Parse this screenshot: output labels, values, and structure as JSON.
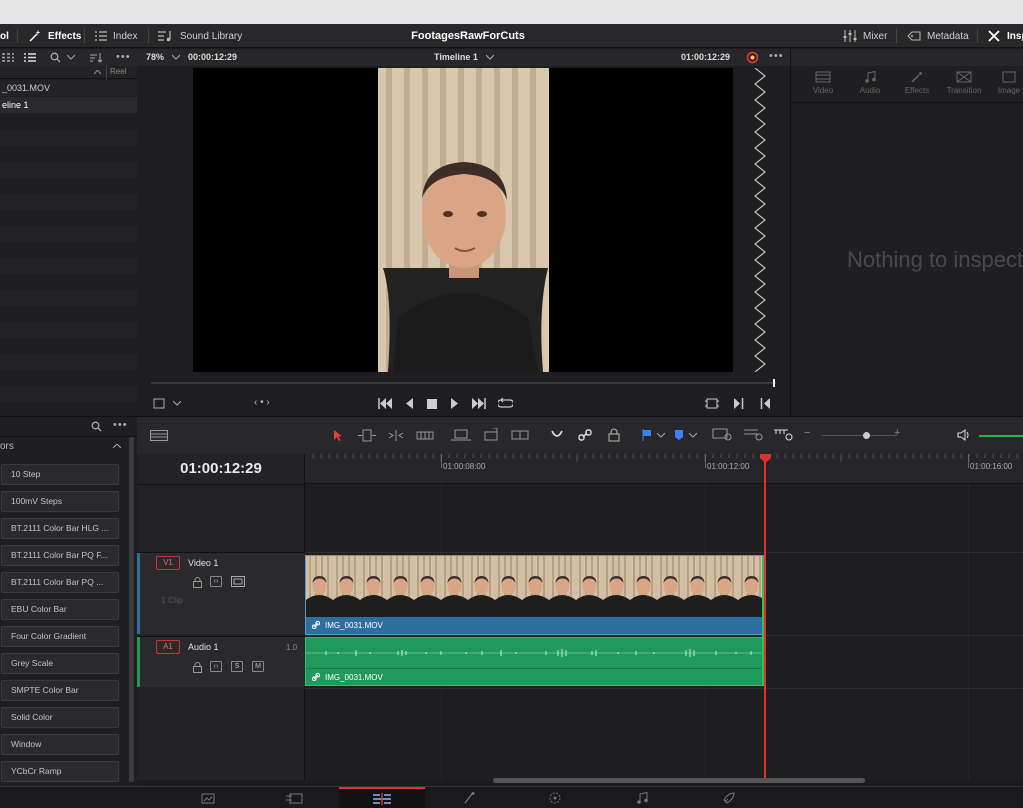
{
  "toolbar": {
    "pool_tab": "ol",
    "effects_tab": "Effects",
    "index_tab": "Index",
    "sound_library_tab": "Sound Library",
    "project_title": "FootagesRawForCuts",
    "mixer_tab": "Mixer",
    "metadata_tab": "Metadata",
    "inspector_tab": "Insp"
  },
  "media_pool": {
    "column_header": "Reel Na",
    "items": [
      {
        "label": "_0031.MOV"
      },
      {
        "label": "eline 1"
      }
    ]
  },
  "viewer": {
    "zoom": "78%",
    "source_timecode": "00:00:12:29",
    "timeline_name": "Timeline 1",
    "record_timecode": "01:00:12:29"
  },
  "inspector": {
    "tabs": [
      "Video",
      "Audio",
      "Effects",
      "Transition",
      "Image"
    ],
    "empty_message": "Nothing to inspect"
  },
  "effects_panel": {
    "section_title": "ors",
    "generators": [
      "10 Step",
      "100mV Steps",
      "BT.2111 Color Bar HLG ...",
      "BT.2111 Color Bar PQ F...",
      "BT.2111 Color Bar PQ ...",
      "EBU Color Bar",
      "Four Color Gradient",
      "Grey Scale",
      "SMPTE Color Bar",
      "Solid Color",
      "Window",
      "YCbCr Ramp"
    ]
  },
  "timeline": {
    "current_timecode": "01:00:12:29",
    "ruler_marks": [
      "01:00:08:00",
      "01:00:12:00",
      "01:00:16:00"
    ],
    "video_track": {
      "badge": "V1",
      "name": "Video 1",
      "clip_count": "1 Clip",
      "clip_name": "IMG_0031.MOV"
    },
    "audio_track": {
      "badge": "A1",
      "name": "Audio 1",
      "level": "1.0",
      "solo": "S",
      "mute": "M",
      "clip_name": "IMG_0031.MOV"
    }
  },
  "colors": {
    "video_clip": "#2d6f9e",
    "audio_clip": "#1f9a5a",
    "playhead": "#e03131",
    "page_active": "#e03131"
  }
}
